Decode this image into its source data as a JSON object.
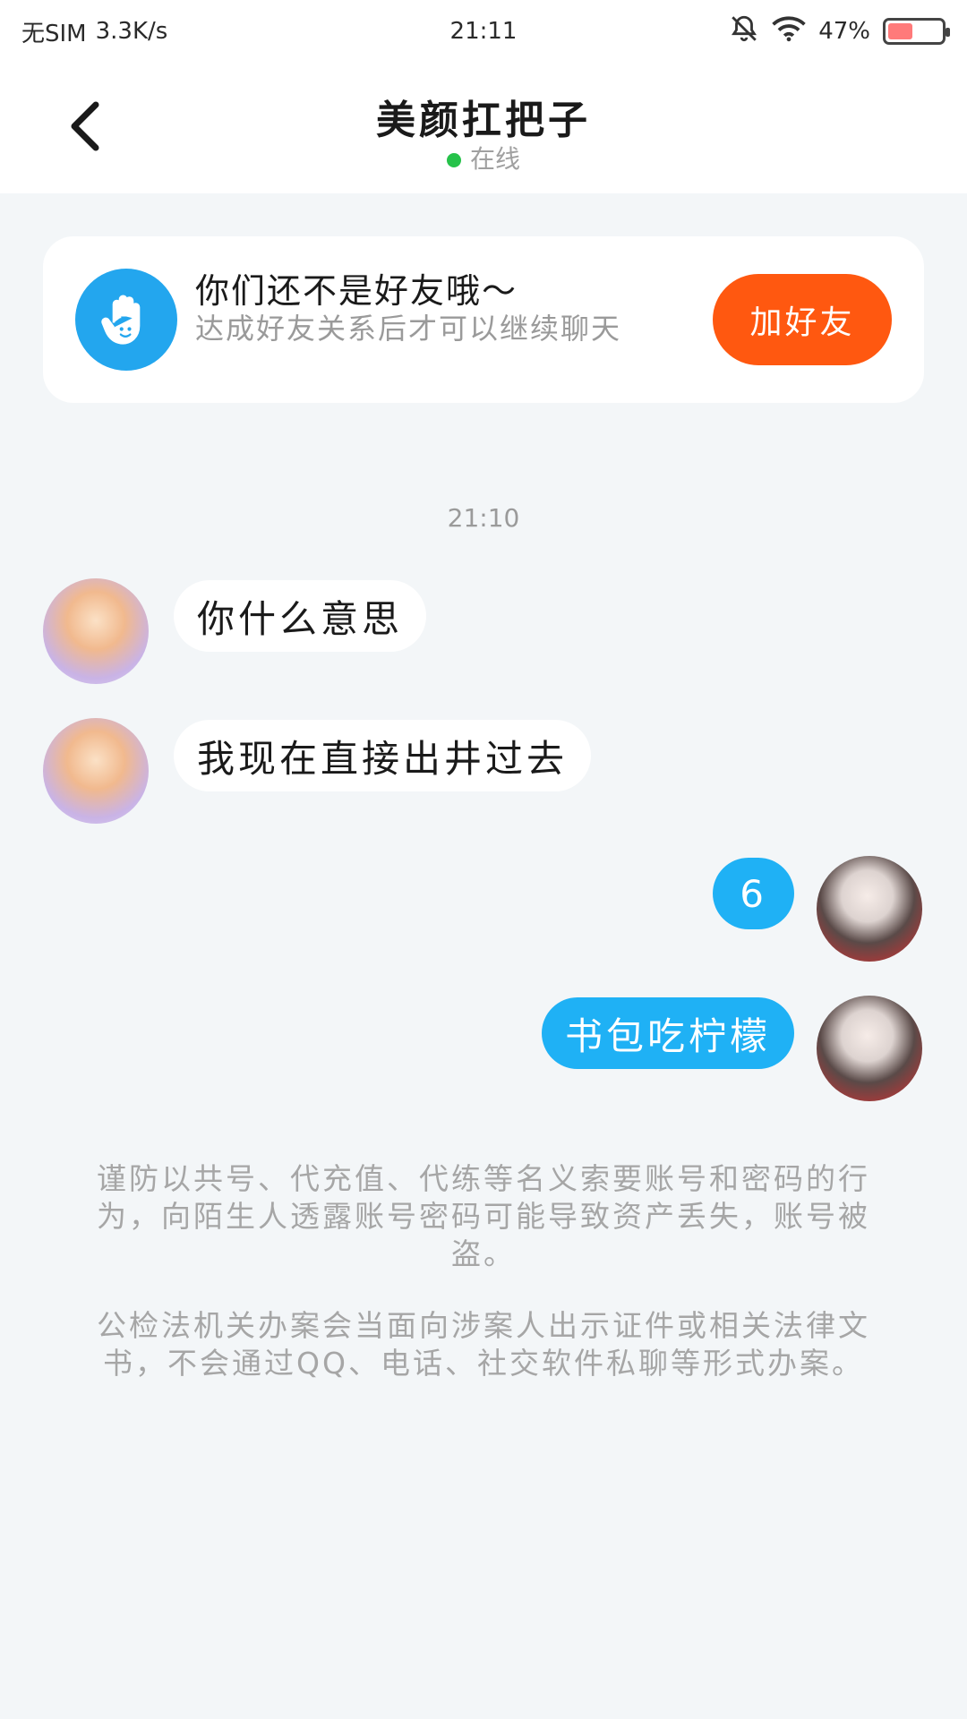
{
  "status_bar": {
    "sim": "无SIM",
    "speed": "3.3K/s",
    "time": "21:11",
    "battery": "47%",
    "battery_level": 0.47
  },
  "header": {
    "title": "美颜扛把子",
    "status": "在线"
  },
  "friend_card": {
    "title": "你们还不是好友哦～",
    "description": "达成好友关系后才可以继续聊天",
    "button": "加好友",
    "button_color": "#ff5810",
    "icon_color": "#23a6ee"
  },
  "chat": {
    "timestamp": "21:10",
    "messages": [
      {
        "side": "in",
        "text": "你什么意思"
      },
      {
        "side": "in",
        "text": "我现在直接出井过去"
      },
      {
        "side": "out",
        "text": "6"
      },
      {
        "side": "out",
        "text": "书包吃柠檬"
      }
    ],
    "outgoing_color": "#1fb1f5"
  },
  "notices": [
    "谨防以共号、代充值、代练等名义索要账号和密码的行为，向陌生人透露账号密码可能导致资产丢失，账号被盗。",
    "公检法机关办案会当面向涉案人出示证件或相关法律文书，不会通过QQ、电话、社交软件私聊等形式办案。"
  ]
}
